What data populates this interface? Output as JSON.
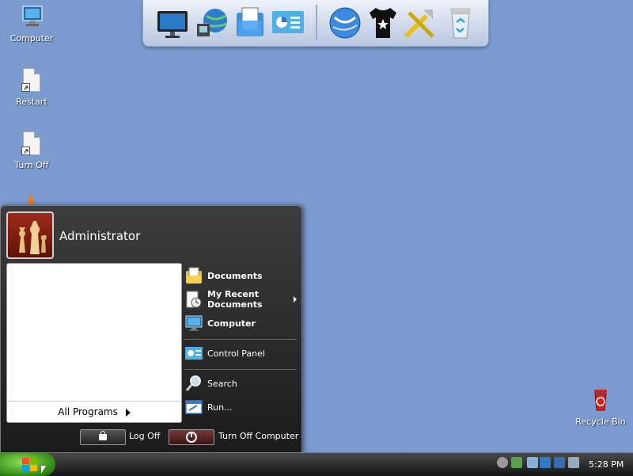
{
  "desktop": {
    "icons": [
      {
        "label": "Computer",
        "icon": "computer-icon"
      },
      {
        "label": "Restart",
        "icon": "shortcut-file-icon"
      },
      {
        "label": "Turn Off",
        "icon": "shortcut-file-icon"
      },
      {
        "label": "Recycle Bin",
        "icon": "recycle-bin-icon"
      }
    ]
  },
  "dock": {
    "items": [
      "monitor-icon",
      "network-globe-icon",
      "documents-folder-icon",
      "control-panel-icon",
      "internet-globe-icon",
      "tshirt-icon",
      "tools-icon",
      "recycle-bin-icon"
    ]
  },
  "start_menu": {
    "user_name": "Administrator",
    "all_programs": "All Programs",
    "right_items": [
      {
        "label": "Documents",
        "icon": "documents-folder-icon",
        "bold": true
      },
      {
        "label": "My Recent Documents",
        "icon": "recent-documents-icon",
        "bold": true
      },
      {
        "label": "Computer",
        "icon": "computer-icon",
        "bold": true
      },
      {
        "label": "Control Panel",
        "icon": "control-panel-icon",
        "bold": false
      },
      {
        "label": "Search",
        "icon": "search-icon",
        "bold": false
      },
      {
        "label": "Run...",
        "icon": "run-icon",
        "bold": false
      }
    ],
    "log_off": "Log Off",
    "turn_off": "Turn Off Computer"
  },
  "taskbar": {
    "clock": "5:28 PM",
    "tray_icons": [
      "volume-icon",
      "network-icon",
      "battery-icon",
      "ime-icon",
      "display-icon",
      "messenger-icon"
    ]
  },
  "colors": {
    "desktop_bg": "#7b9bd0",
    "start_green": "#2e8a14",
    "menu_bg": "#2a2a2a"
  }
}
